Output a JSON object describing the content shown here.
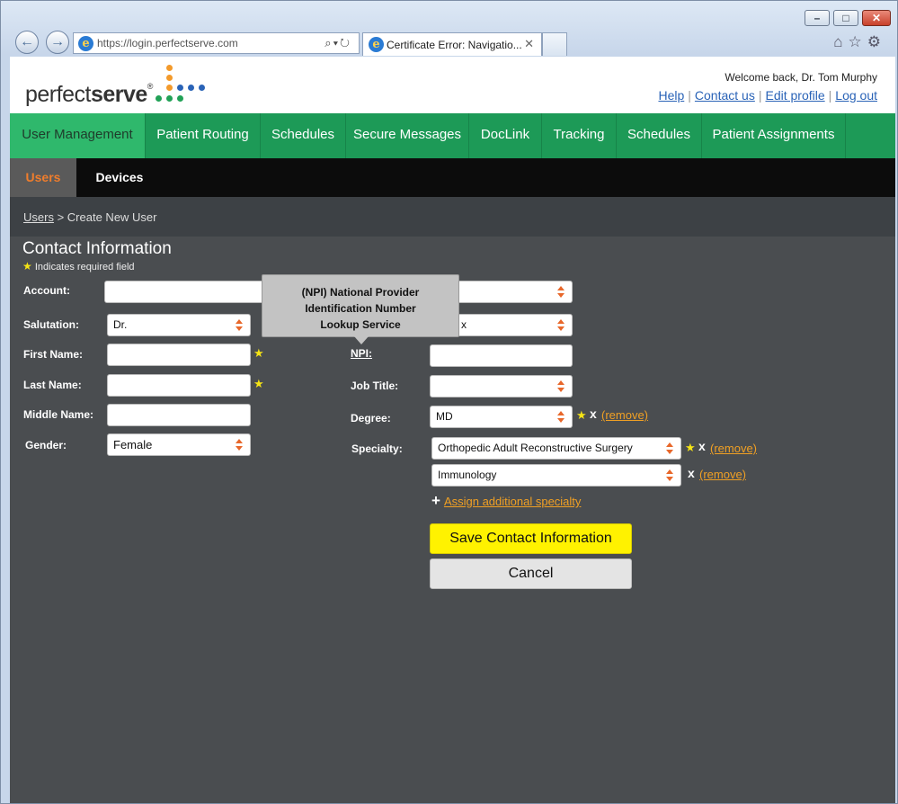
{
  "browser": {
    "url": "https://login.perfectserve.com",
    "tab_title": "Certificate Error: Navigatio...",
    "minimize_glyph": "–",
    "maximize_glyph": "□",
    "close_glyph": "✕",
    "tab_close": "✕"
  },
  "header": {
    "logo_light": "perfect",
    "logo_bold": "serve",
    "logo_reg": "®",
    "welcome": "Welcome back, Dr. Tom Murphy",
    "links": {
      "help": "Help",
      "contact": "Contact us",
      "edit": "Edit profile",
      "logout": "Log out"
    },
    "logo_dot_colors": [
      "#f39a2b",
      "#21a156",
      "#2a63b7"
    ]
  },
  "main_nav": {
    "items": [
      {
        "label": "User Management",
        "active": true
      },
      {
        "label": "Patient Routing"
      },
      {
        "label": "Schedules"
      },
      {
        "label": "Secure Messages"
      },
      {
        "label": "DocLink"
      },
      {
        "label": "Tracking"
      },
      {
        "label": "Schedules"
      },
      {
        "label": "Patient Assignments"
      }
    ]
  },
  "sub_nav": {
    "items": [
      {
        "label": "Users",
        "active": true
      },
      {
        "label": "Devices"
      }
    ]
  },
  "breadcrumb": {
    "link": "Users",
    "separator": ">",
    "current": "Create New User"
  },
  "form": {
    "title": "Contact Information",
    "required_note": "Indicates required field",
    "required_star": "★",
    "left": {
      "account_label": "Account:",
      "account_value": "",
      "salutation_label": "Salutation:",
      "salutation_value": "Dr.",
      "first_name_label": "First Name:",
      "first_name_value": "",
      "last_name_label": "Last Name:",
      "last_name_value": "",
      "middle_name_label": "Middle Name:",
      "middle_name_value": "",
      "gender_label": "Gender:",
      "gender_value": "Female"
    },
    "right": {
      "row1_value": "",
      "row2_value": "x",
      "npi_label": "NPI:",
      "npi_value": "",
      "job_title_label": "Job Title:",
      "job_title_value": "",
      "degree_label": "Degree:",
      "degree_value": "MD",
      "specialty_label": "Specialty:",
      "specialty_1": "Orthopedic Adult Reconstructive Surgery",
      "specialty_2": "Immunology",
      "remove_x": "x",
      "remove_label": "(remove)",
      "add_specialty_plus": "+",
      "add_specialty": "Assign additional specialty"
    },
    "tooltip": {
      "line1": "(NPI) National Provider",
      "line2": "Identification Number",
      "line3": "Lookup Service"
    },
    "buttons": {
      "save": "Save Contact Information",
      "cancel": "Cancel"
    }
  },
  "colors": {
    "nav_green": "#1d9a57",
    "nav_active": "#2fb86c",
    "accent_orange": "#ef7d2c",
    "save_yellow": "#fff200",
    "link_orange": "#f0a024",
    "required_yellow": "#f5e415"
  }
}
